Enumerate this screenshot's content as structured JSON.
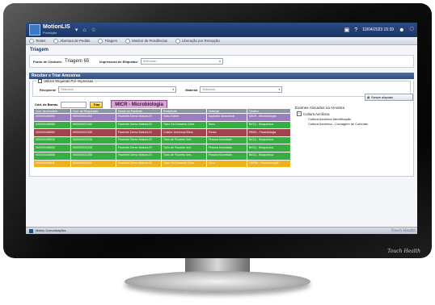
{
  "app": {
    "name": "MotionLIS",
    "subtitle": "Produção",
    "datetime": "10/04/2023 15:39"
  },
  "nav": {
    "items": [
      "Testes",
      "Abertura de Pedido",
      "Triagem",
      "Monitor de Pendências",
      "Liberação por Recepção"
    ]
  },
  "page": {
    "title": "Triagem"
  },
  "top": {
    "ponto_label": "Ponto de Controle:",
    "ponto_value": "Triagem 65",
    "impressora_label": "Impressora de Etiquetas:",
    "impressora_value": "Selecione..."
  },
  "panel": {
    "title": "Receber e Triar Amostras",
    "legend": "Utilizar Etiquetas Pré-Impressas",
    "recipiente_label": "Recipiente",
    "recipiente_value": "Selecione...",
    "material_label": "Material",
    "material_value": "Selecione...",
    "cod_label": "Cód. de Barras",
    "btn_label": "Triar",
    "sector": "MICR - Microbiologia",
    "columns": [
      "Cód. da Amostra",
      "Cód. da Requisição",
      "Nome do Paciente",
      "Recipiente",
      "Material",
      "Destino"
    ],
    "rows": [
      {
        "color": "#9a7ec2",
        "cells": [
          "000000408990",
          "500000031342",
          "Paciente Demo MotionLIS",
          "Tubo Estéril",
          "Aspirado Abdominal",
          "MICR - Microbiologia"
        ]
      },
      {
        "color": "#37ad43",
        "cells": [
          "000000408980",
          "500000031342",
          "Paciente Demo MotionLIS",
          "Tubo Gel Amarelo 10mL",
          "Soro",
          "BIOQ - Bioquímica"
        ]
      },
      {
        "color": "#a1424e",
        "cells": [
          "000000408960",
          "500000031335",
          "Paciente Demo MotionLIS",
          "Coletor Universal 80mL",
          "Fezes",
          "PARA - Parasitologia"
        ]
      },
      {
        "color": "#37ad43",
        "cells": [
          "000000408930",
          "500000031328",
          "Paciente Demo MotionLIS",
          "Tubo de Fluoreto 4mL",
          "Plasma fluoretado",
          "BIOQ - Bioquímica"
        ]
      },
      {
        "color": "#37ad43",
        "cells": [
          "000000408900",
          "500000031328",
          "Paciente Demo MotionLIS",
          "Tubo de Fluoreto 4mL",
          "Plasma fluoretado",
          "BIOQ - Bioquímica"
        ]
      },
      {
        "color": "#37ad43",
        "cells": [
          "000000408855",
          "500000031308",
          "Paciente Demo MotionLIS",
          "Tubo de Fluoreto 4mL",
          "Plasma fluoretado",
          "BIOQ - Bioquímica"
        ]
      },
      {
        "color": "#f0b21a",
        "cells": [
          "000000408811",
          "500000031320",
          "Paciente Demo MotionLIS",
          "Tubo Gel Amarelo 10mL",
          "Soro",
          "HORM - Hormonologia"
        ]
      }
    ],
    "romper_label": "Romper alíquotas",
    "exams_title": "Exames Alocados na Amostra",
    "exam_group": "Cultura Aeróbica",
    "exam_items": [
      "Cultura Aeróbica Identificação",
      "Cultura Aeróbica - Contagem de Colônias"
    ]
  },
  "status": {
    "text": "Motion Comunicações",
    "logo": "Touch Health"
  },
  "monitor": {
    "brand": "Touch Health"
  }
}
